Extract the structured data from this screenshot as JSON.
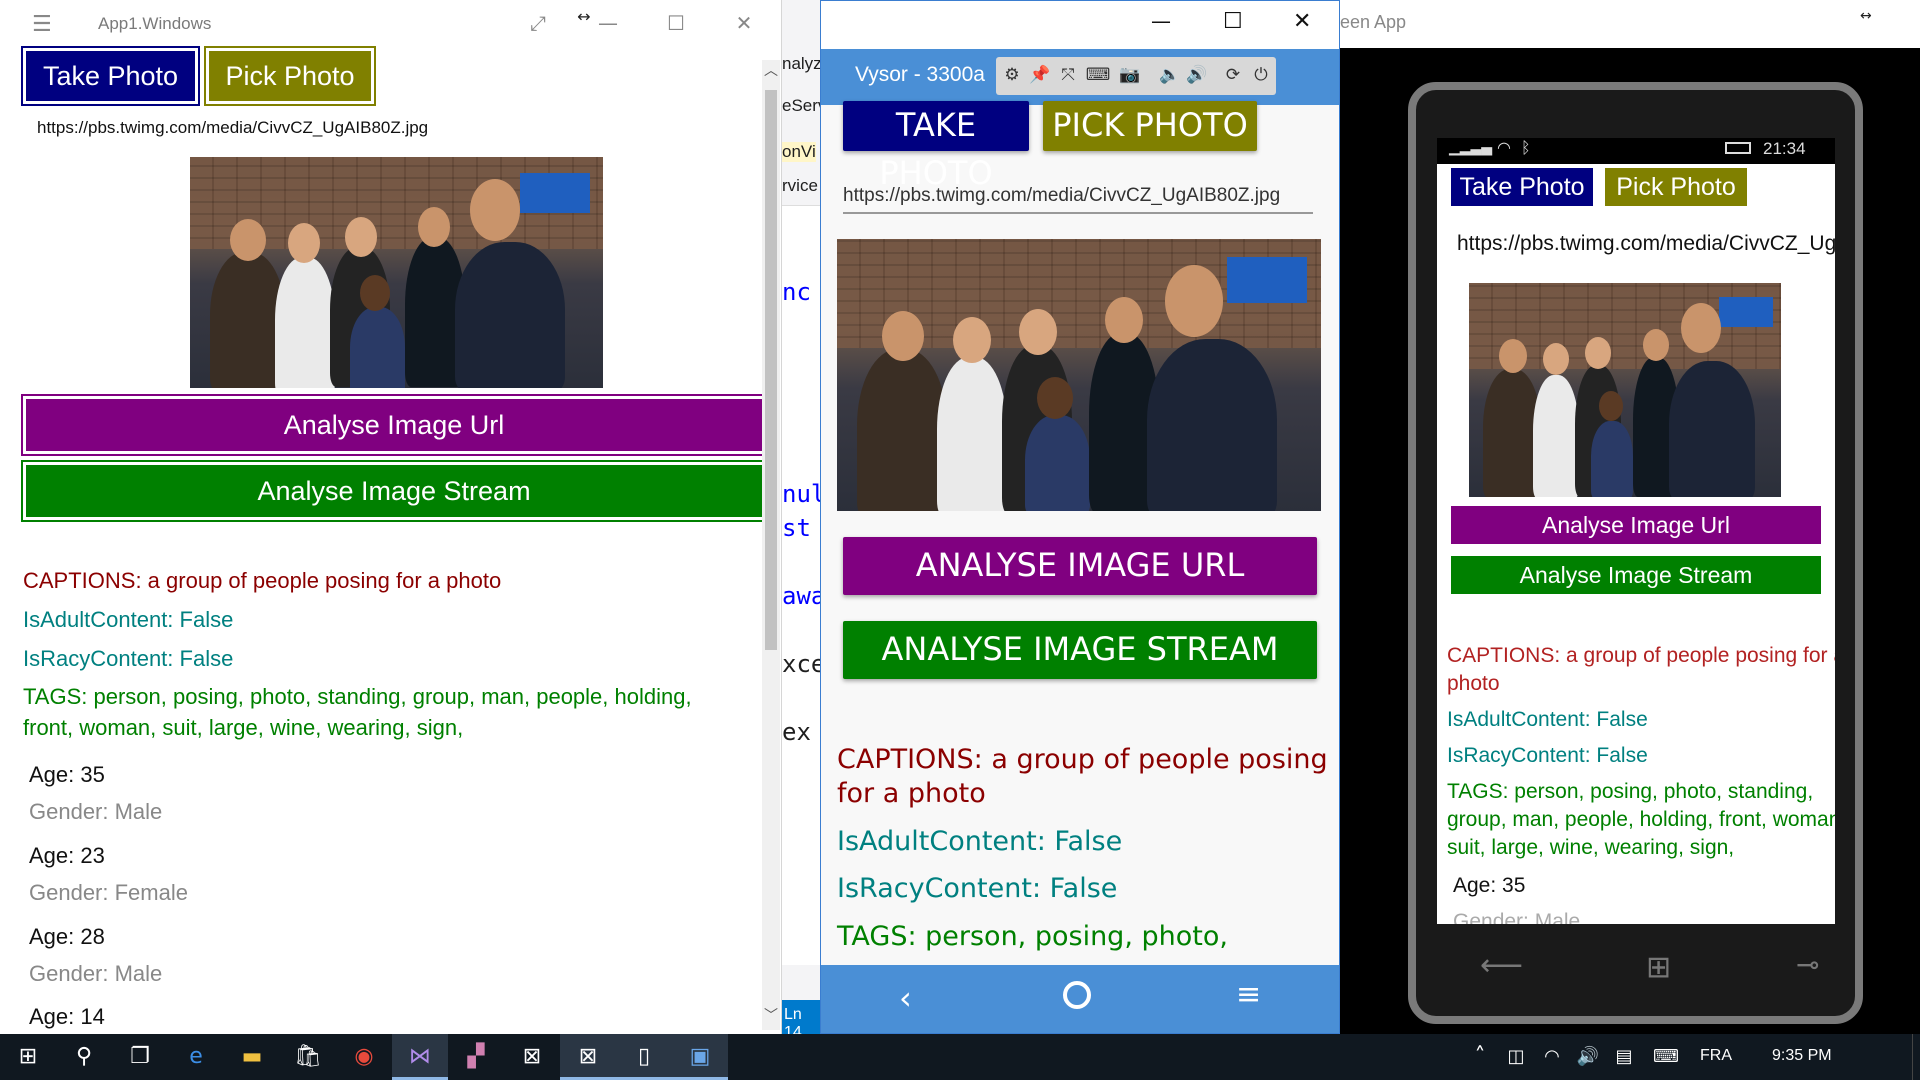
{
  "uwp": {
    "title": "App1.Windows",
    "take_photo": "Take Photo",
    "pick_photo": "Pick Photo",
    "url": "https://pbs.twimg.com/media/CivvCZ_UgAIB80Z.jpg",
    "analyse_url": "Analyse Image Url",
    "analyse_stream": "Analyse Image Stream",
    "captions": "CAPTIONS: a group of people posing for a photo",
    "adult": "IsAdultContent: False",
    "racy": "IsRacyContent: False",
    "tags_line1": "TAGS: person, posing, photo, standing, group, man, people, holding,",
    "tags_line2": "front, woman, suit, large, wine, wearing, sign,",
    "faces": [
      {
        "age": "Age: 35",
        "gender": "Gender: Male"
      },
      {
        "age": "Age: 23",
        "gender": "Gender: Female"
      },
      {
        "age": "Age: 28",
        "gender": "Gender: Male"
      },
      {
        "age": "Age: 14",
        "gender": ""
      }
    ]
  },
  "vs_fragments": [
    "nalyz",
    "eServ",
    "onVi",
    "rvice",
    "nc",
    "nul",
    "st",
    "awa",
    "xce",
    "ex",
    "Ln 14"
  ],
  "vysor": {
    "title": "Vysor  -  3300a",
    "take_photo": "TAKE PHOTO",
    "pick_photo": "PICK PHOTO",
    "url": "https://pbs.twimg.com/media/CivvCZ_UgAIB80Z.jpg",
    "analyse_url": "ANALYSE IMAGE URL",
    "analyse_stream": "ANALYSE IMAGE STREAM",
    "captions_line1": "CAPTIONS: a group of people posing",
    "captions_line2": "for a photo",
    "adult": "IsAdultContent: False",
    "racy": "IsRacyContent: False",
    "tags": "TAGS: person, posing, photo,",
    "tools": [
      "gear-icon",
      "pin-icon",
      "fullscreen-icon",
      "keyboard-icon",
      "camera-icon",
      "volume-down-icon",
      "volume-up-icon",
      "rotate-icon",
      "power-icon"
    ]
  },
  "emulator": {
    "title_fragment": "een App",
    "time": "21:34",
    "take_photo": "Take Photo",
    "pick_photo": "Pick Photo",
    "url": "https://pbs.twimg.com/media/CivvCZ_UgA",
    "analyse_url": "Analyse Image Url",
    "analyse_stream": "Analyse Image Stream",
    "captions_line1": "CAPTIONS: a group of people posing for a",
    "captions_line2": "photo",
    "adult": "IsAdultContent: False",
    "racy": "IsRacyContent: False",
    "tags_line1": "TAGS: person, posing, photo, standing,",
    "tags_line2": "group, man, people, holding, front, woman,",
    "tags_line3": "suit, large, wine, wearing, sign,",
    "age": "Age: 35",
    "gender_partial": "Gender: Male"
  },
  "taskbar": {
    "language": "FRA",
    "time": "9:35 PM"
  },
  "colors": {
    "navy": "#000080",
    "olive": "#808000",
    "purple": "#800080",
    "green": "#008000",
    "caption_red": "#8b0000",
    "teal": "#008080",
    "vysor_blue": "#4a8fd6"
  }
}
